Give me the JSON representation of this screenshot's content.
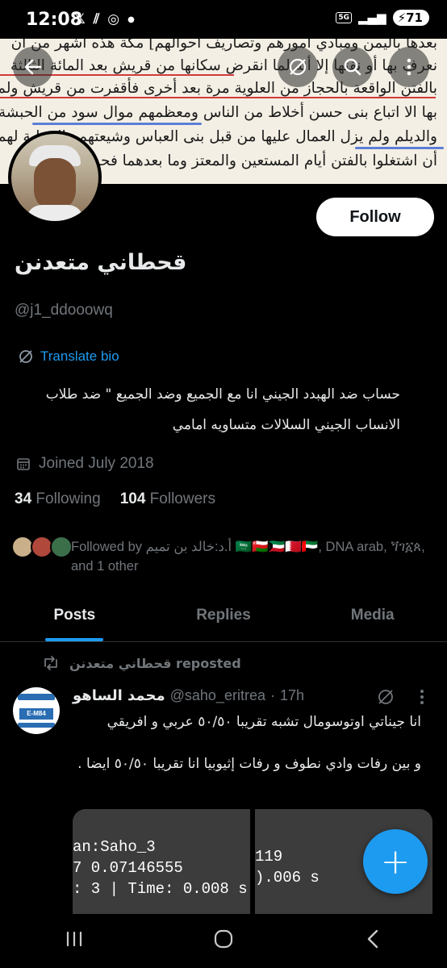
{
  "status_bar": {
    "time": "12:08",
    "notif_icons": [
      "x-icon",
      "pattern-icon",
      "whatsapp-icon",
      "dot-icon"
    ],
    "network": "5G",
    "battery": "71"
  },
  "banner": {
    "lines": [
      "بعدها باليمن ومبادي أمورهم وتصاريف أحوالهم] مكة هذه أشهر من أن",
      "نعرف بها أو نفنها إلا أنه لما انقرض سكانها من قريش بعد المائة الثالثة",
      "بالفتن الواقعة بالحجاز من العلوية مرة بعد أخرى فأقفرت من قريش ولم يبق",
      "بها الا اتباع بنى حسن أخلاط من الناس ومعظمهم موال سود من الحبشة",
      "والديلم ولم يزل العمال عليها من قبل بنى العباس وشيعتهم والخطبة لهم الى",
      "أن اشتغلوا بالفتن أيام المستعين والمعتز وما بعدهما فحدث"
    ]
  },
  "header_buttons": [
    "back-icon",
    "translate-icon",
    "search-icon",
    "more-icon"
  ],
  "profile": {
    "name": "قحطاني متعدنن",
    "handle": "@j1_ddooowq",
    "follow_label": "Follow",
    "translate_label": "Translate bio",
    "bio": "حساب ضد الهبدد الجيني انا مع الجميع وضد الجميع \" ضد طلاب الانساب الجيني السلالات متساويه امامي",
    "joined": "Joined July 2018",
    "following_count": "34",
    "following_label": "Following",
    "followers_count": "104",
    "followers_label": "Followers",
    "followed_by": "Followed by أ.د:خالد بن تميم 🇸🇦🇴🇲🇰🇼🇧🇭🇦🇪, DNA arab, ጘገ፩ጰ, and 1 other"
  },
  "tabs": [
    {
      "label": "Posts",
      "active": true
    },
    {
      "label": "Replies",
      "active": false
    },
    {
      "label": "Media",
      "active": false
    }
  ],
  "post": {
    "repost_label": "قحطاني متعدنن reposted",
    "author_name": "محمد الساهو",
    "author_handle": "@saho_eritrea",
    "time": "17h",
    "text_1": "انا جيناتي اوتوسومال تشبه تقريبا ٥٠/٥٠ عربي و افريقي",
    "text_2": "و بين رفات وادي نطوف و رفات إثيوبيا انا تقريبا ٥٠/٥٠ ايضا .",
    "media_1_lines": [
      "an:Saho_3",
      "7 0.07146555",
      ": 3 | Time: 0.008 s"
    ],
    "media_2_lines": [
      "119",
      ").006 s"
    ],
    "avatar_text": "E-M84"
  },
  "fab_label": "+",
  "colors": {
    "accent": "#1d9bf0",
    "background": "#000000",
    "text": "#e7e9ea",
    "muted": "#71767b"
  }
}
